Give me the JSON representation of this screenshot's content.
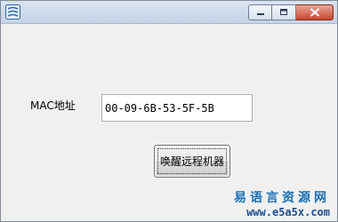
{
  "form": {
    "mac_label": "MAC地址",
    "mac_value": "00-09-6B-53-5F-5B",
    "wake_button_label": "唤醒远程机器"
  },
  "watermark": {
    "site_name": "易语言资源网",
    "site_url": "www.e5a5x.com"
  }
}
